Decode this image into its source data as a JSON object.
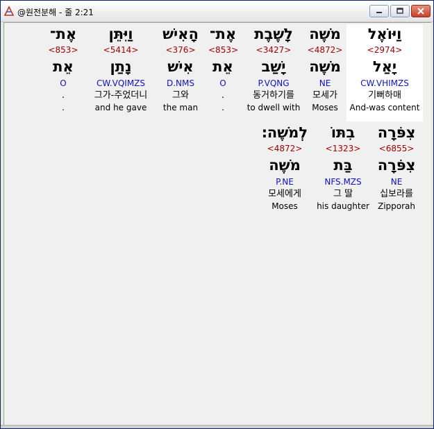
{
  "window": {
    "title": "@원전분해 - 줄 2:21"
  },
  "colors": {
    "strong": "#A00000",
    "morph": "#1010C0",
    "selected_bg": "#FFFFFF"
  },
  "rows": [
    {
      "words": [
        {
          "hebrew": "וַיּוֹאֶל",
          "strong": "<2974>",
          "lexeme": "יָאַל",
          "morph": "CW.VHIMZS",
          "korean": "기뻐하매",
          "english": "And-was content",
          "selected": true
        },
        {
          "hebrew": "מֹשֶׁה",
          "strong": "<4872>",
          "lexeme": "מֹשֶׁה",
          "morph": "NE",
          "korean": "모세가",
          "english": "Moses",
          "selected": false
        },
        {
          "hebrew": "לָשֶׁבֶת",
          "strong": "<3427>",
          "lexeme": "יָשַׁב",
          "morph": "P.VQNG",
          "korean": "동거하기를",
          "english": "to dwell with",
          "selected": false
        },
        {
          "hebrew": "אֶת־",
          "strong": "<853>",
          "lexeme": "אֵת",
          "morph": "O",
          "korean": ".",
          "english": ".",
          "selected": false
        },
        {
          "hebrew": "הָאִישׁ",
          "strong": "<376>",
          "lexeme": "אִישׁ",
          "morph": "D.NMS",
          "korean": "그와",
          "english": "the man",
          "selected": false
        },
        {
          "hebrew": "וַיִּתֵּן",
          "strong": "<5414>",
          "lexeme": "נָתַן",
          "morph": "CW.VQIMZS",
          "korean": "그가-주었더니",
          "english": "and he gave",
          "selected": false
        },
        {
          "hebrew": "אֶת־",
          "strong": "<853>",
          "lexeme": "אֵת",
          "morph": "O",
          "korean": ".",
          "english": ".",
          "selected": false
        }
      ]
    },
    {
      "words": [
        {
          "hebrew": "צִפֹּרָה",
          "strong": "<6855>",
          "lexeme": "צִפֹּרָה",
          "morph": "NE",
          "korean": "십보라를",
          "english": "Zipporah",
          "selected": false
        },
        {
          "hebrew": "בִתּוֹ",
          "strong": "<1323>",
          "lexeme": "בַּת",
          "morph": "NFS.MZS",
          "korean": "그 딸",
          "english": "his daughter",
          "selected": false
        },
        {
          "hebrew": "לְמֹשֶׁה׃",
          "strong": "<4872>",
          "lexeme": "מֹשֶׁה",
          "morph": "P.NE",
          "korean": "모세에게",
          "english": "Moses",
          "selected": false
        }
      ]
    }
  ]
}
